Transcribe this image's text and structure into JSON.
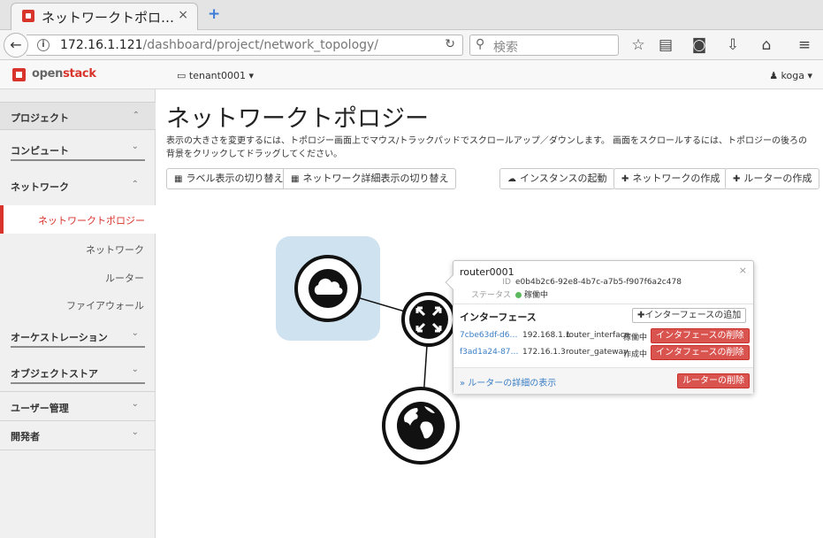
{
  "browser": {
    "tab_title": "ネットワークトポロ…",
    "tab_close": "×",
    "new_tab": "+",
    "url_host": "172.16.1.121",
    "url_path": "/dashboard/project/network_topology/",
    "search_placeholder": "検索"
  },
  "header": {
    "logo_brand": "open",
    "logo_suffix": "stack",
    "tenant": "tenant0001 ▾",
    "user": "koga ▾"
  },
  "sidebar": {
    "project": "プロジェクト",
    "compute": "コンピュート",
    "network": "ネットワーク",
    "active_item": "ネットワークトポロジー",
    "sub_network": "ネットワーク",
    "sub_router": "ルーター",
    "sub_firewall": "ファイアウォール",
    "orchestration": "オーケストレーション",
    "object_store": "オブジェクトストア",
    "user_mgmt": "ユーザー管理",
    "developer": "開発者"
  },
  "main": {
    "title": "ネットワークトポロジー",
    "description": "表示の大きさを変更するには、トポロジー画面上でマウス/トラックパッドでスクロールアップ／ダウンします。 画面をスクロールするには、トポロジーの後ろの背景をクリックしてドラッグしてください。",
    "btn_label_toggle": "ラベル表示の切り替え",
    "btn_detail_toggle": "ネットワーク詳細表示の切り替え",
    "btn_launch_instance": "インスタンスの起動",
    "btn_create_network": "ネットワークの作成",
    "btn_create_router": "ルーターの作成"
  },
  "popup": {
    "title": "router0001",
    "close": "×",
    "id_key": "ID",
    "id_value": "e0b4b2c6-92e8-4b7c-a7b5-f907f6a2c478",
    "status_key": "ステータス",
    "status_value": "稼働中",
    "section": "インターフェース",
    "add_interface": "インターフェースの追加",
    "interfaces": [
      {
        "id": "7cbe63df-d6…",
        "ip": "192.168.1.1",
        "type": "router_interface",
        "status": "稼働中",
        "action": "インタフェースの削除"
      },
      {
        "id": "f3ad1a24-87…",
        "ip": "172.16.1.3",
        "type": "router_gateway",
        "status": "作成中",
        "action": "インタフェースの削除"
      }
    ],
    "detail_link": "» ルーターの詳細の表示",
    "delete_router": "ルーターの削除"
  },
  "colors": {
    "brand": "#d9342b",
    "danger": "#d9534f",
    "link": "#3a7ec4",
    "network_bg": "#cfe2f0"
  }
}
